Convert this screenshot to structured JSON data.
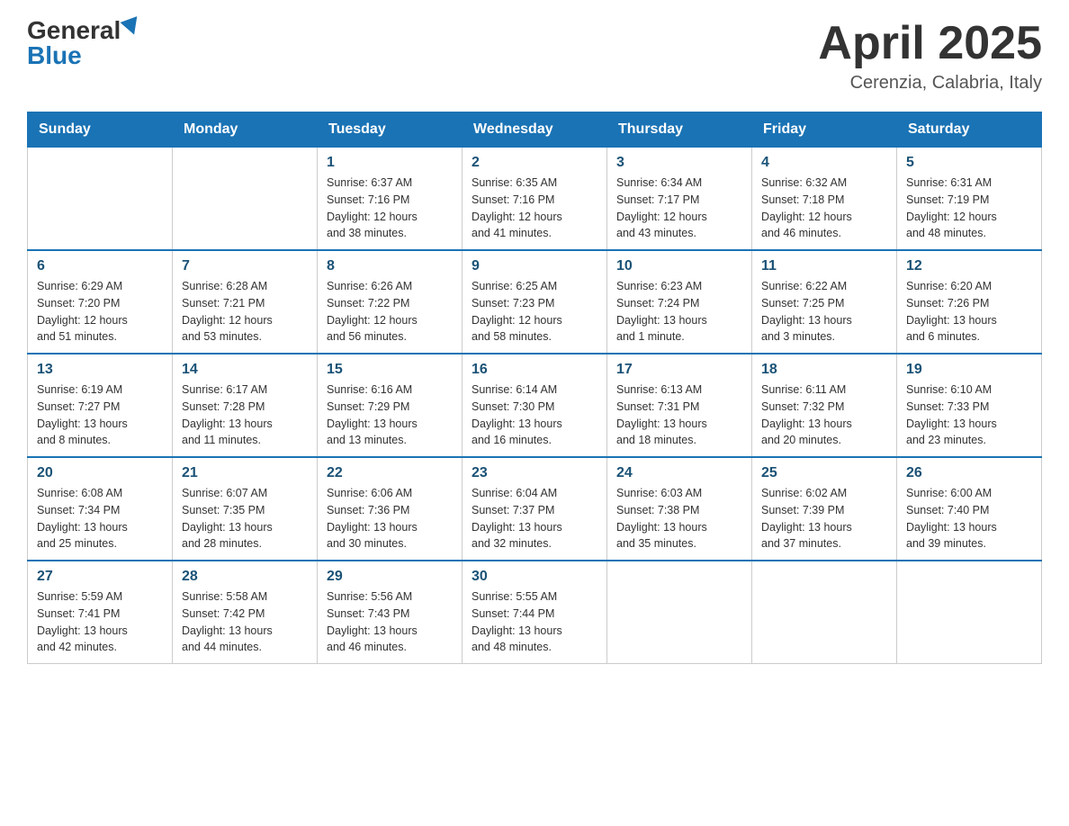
{
  "header": {
    "logo_general": "General",
    "logo_blue": "Blue",
    "month_title": "April 2025",
    "subtitle": "Cerenzia, Calabria, Italy"
  },
  "days_of_week": [
    "Sunday",
    "Monday",
    "Tuesday",
    "Wednesday",
    "Thursday",
    "Friday",
    "Saturday"
  ],
  "weeks": [
    [
      {
        "day": "",
        "info": ""
      },
      {
        "day": "",
        "info": ""
      },
      {
        "day": "1",
        "info": "Sunrise: 6:37 AM\nSunset: 7:16 PM\nDaylight: 12 hours\nand 38 minutes."
      },
      {
        "day": "2",
        "info": "Sunrise: 6:35 AM\nSunset: 7:16 PM\nDaylight: 12 hours\nand 41 minutes."
      },
      {
        "day": "3",
        "info": "Sunrise: 6:34 AM\nSunset: 7:17 PM\nDaylight: 12 hours\nand 43 minutes."
      },
      {
        "day": "4",
        "info": "Sunrise: 6:32 AM\nSunset: 7:18 PM\nDaylight: 12 hours\nand 46 minutes."
      },
      {
        "day": "5",
        "info": "Sunrise: 6:31 AM\nSunset: 7:19 PM\nDaylight: 12 hours\nand 48 minutes."
      }
    ],
    [
      {
        "day": "6",
        "info": "Sunrise: 6:29 AM\nSunset: 7:20 PM\nDaylight: 12 hours\nand 51 minutes."
      },
      {
        "day": "7",
        "info": "Sunrise: 6:28 AM\nSunset: 7:21 PM\nDaylight: 12 hours\nand 53 minutes."
      },
      {
        "day": "8",
        "info": "Sunrise: 6:26 AM\nSunset: 7:22 PM\nDaylight: 12 hours\nand 56 minutes."
      },
      {
        "day": "9",
        "info": "Sunrise: 6:25 AM\nSunset: 7:23 PM\nDaylight: 12 hours\nand 58 minutes."
      },
      {
        "day": "10",
        "info": "Sunrise: 6:23 AM\nSunset: 7:24 PM\nDaylight: 13 hours\nand 1 minute."
      },
      {
        "day": "11",
        "info": "Sunrise: 6:22 AM\nSunset: 7:25 PM\nDaylight: 13 hours\nand 3 minutes."
      },
      {
        "day": "12",
        "info": "Sunrise: 6:20 AM\nSunset: 7:26 PM\nDaylight: 13 hours\nand 6 minutes."
      }
    ],
    [
      {
        "day": "13",
        "info": "Sunrise: 6:19 AM\nSunset: 7:27 PM\nDaylight: 13 hours\nand 8 minutes."
      },
      {
        "day": "14",
        "info": "Sunrise: 6:17 AM\nSunset: 7:28 PM\nDaylight: 13 hours\nand 11 minutes."
      },
      {
        "day": "15",
        "info": "Sunrise: 6:16 AM\nSunset: 7:29 PM\nDaylight: 13 hours\nand 13 minutes."
      },
      {
        "day": "16",
        "info": "Sunrise: 6:14 AM\nSunset: 7:30 PM\nDaylight: 13 hours\nand 16 minutes."
      },
      {
        "day": "17",
        "info": "Sunrise: 6:13 AM\nSunset: 7:31 PM\nDaylight: 13 hours\nand 18 minutes."
      },
      {
        "day": "18",
        "info": "Sunrise: 6:11 AM\nSunset: 7:32 PM\nDaylight: 13 hours\nand 20 minutes."
      },
      {
        "day": "19",
        "info": "Sunrise: 6:10 AM\nSunset: 7:33 PM\nDaylight: 13 hours\nand 23 minutes."
      }
    ],
    [
      {
        "day": "20",
        "info": "Sunrise: 6:08 AM\nSunset: 7:34 PM\nDaylight: 13 hours\nand 25 minutes."
      },
      {
        "day": "21",
        "info": "Sunrise: 6:07 AM\nSunset: 7:35 PM\nDaylight: 13 hours\nand 28 minutes."
      },
      {
        "day": "22",
        "info": "Sunrise: 6:06 AM\nSunset: 7:36 PM\nDaylight: 13 hours\nand 30 minutes."
      },
      {
        "day": "23",
        "info": "Sunrise: 6:04 AM\nSunset: 7:37 PM\nDaylight: 13 hours\nand 32 minutes."
      },
      {
        "day": "24",
        "info": "Sunrise: 6:03 AM\nSunset: 7:38 PM\nDaylight: 13 hours\nand 35 minutes."
      },
      {
        "day": "25",
        "info": "Sunrise: 6:02 AM\nSunset: 7:39 PM\nDaylight: 13 hours\nand 37 minutes."
      },
      {
        "day": "26",
        "info": "Sunrise: 6:00 AM\nSunset: 7:40 PM\nDaylight: 13 hours\nand 39 minutes."
      }
    ],
    [
      {
        "day": "27",
        "info": "Sunrise: 5:59 AM\nSunset: 7:41 PM\nDaylight: 13 hours\nand 42 minutes."
      },
      {
        "day": "28",
        "info": "Sunrise: 5:58 AM\nSunset: 7:42 PM\nDaylight: 13 hours\nand 44 minutes."
      },
      {
        "day": "29",
        "info": "Sunrise: 5:56 AM\nSunset: 7:43 PM\nDaylight: 13 hours\nand 46 minutes."
      },
      {
        "day": "30",
        "info": "Sunrise: 5:55 AM\nSunset: 7:44 PM\nDaylight: 13 hours\nand 48 minutes."
      },
      {
        "day": "",
        "info": ""
      },
      {
        "day": "",
        "info": ""
      },
      {
        "day": "",
        "info": ""
      }
    ]
  ]
}
